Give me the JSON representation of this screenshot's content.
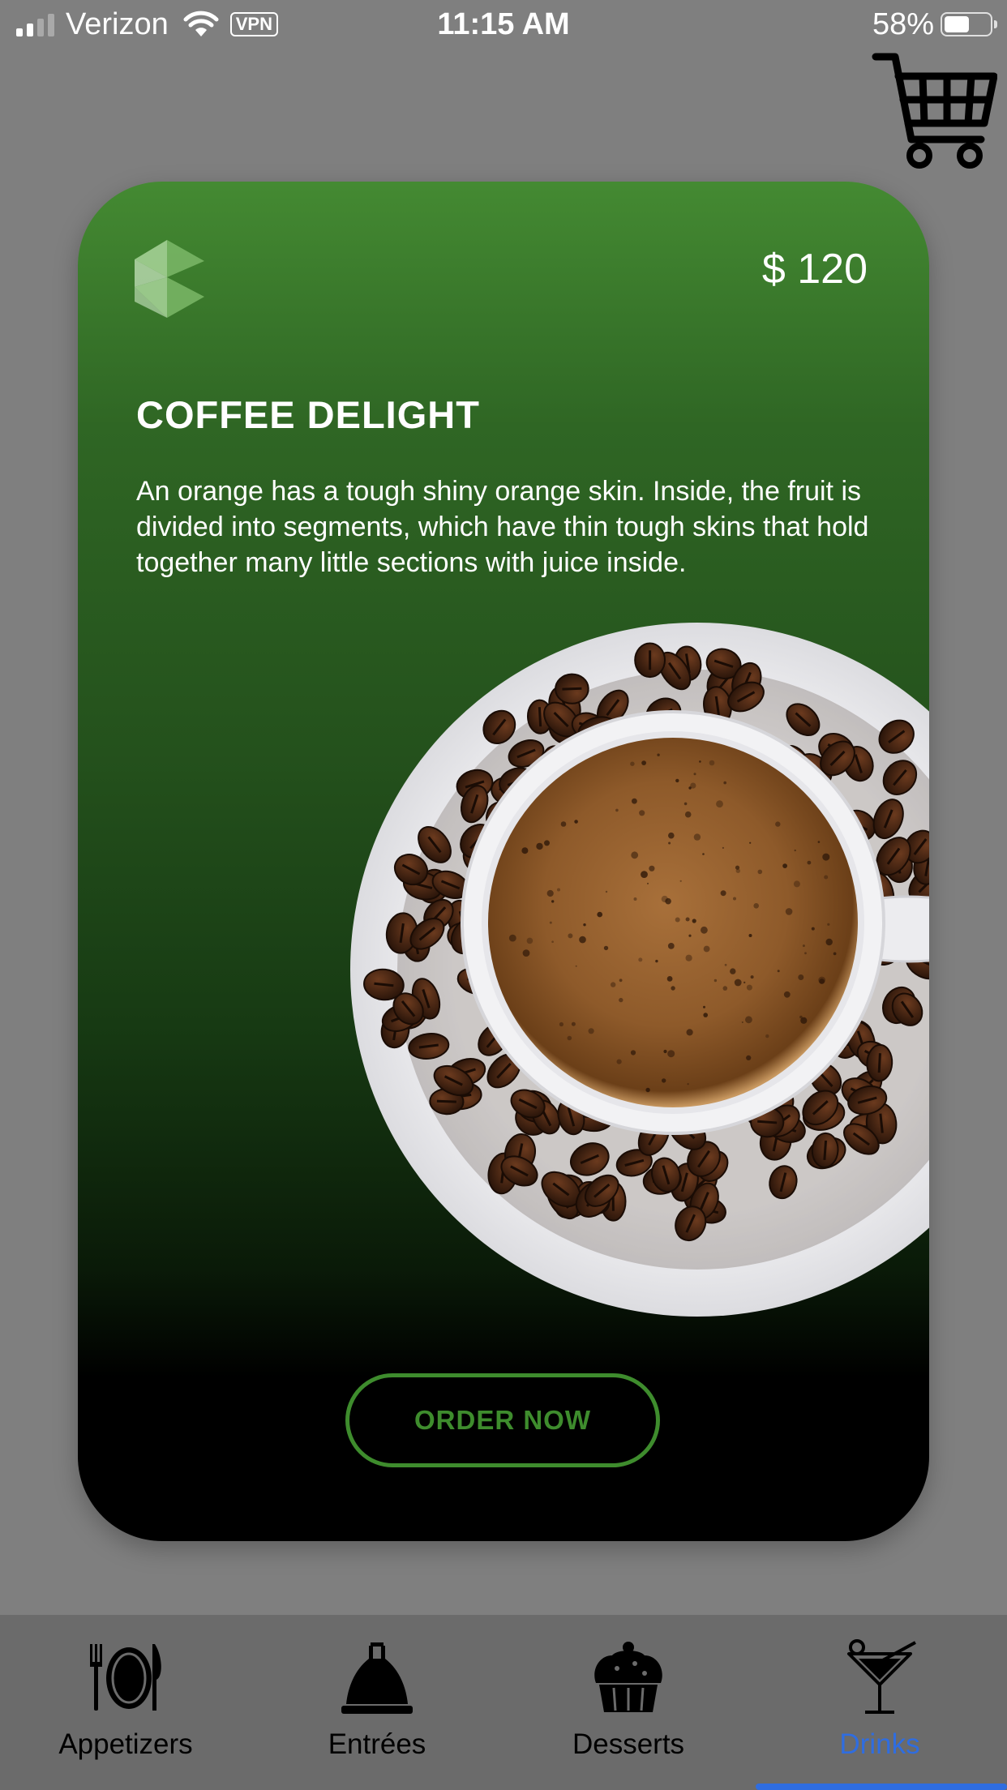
{
  "status_bar": {
    "carrier": "Verizon",
    "vpn": "VPN",
    "time": "11:15 AM",
    "battery": "58%",
    "battery_level": 0.58
  },
  "card": {
    "price": "$ 120",
    "title": "COFFEE DELIGHT",
    "description": "An orange has a tough shiny orange skin. Inside, the fruit is divided into segments, which have thin tough skins that hold together many little sections with juice inside.",
    "button_label": "ORDER NOW",
    "accent_color": "#3e8c2d"
  },
  "icons": {
    "cart": "shopping-cart-icon",
    "logo": "brand-logo-icon"
  },
  "tabs": [
    {
      "label": "Appetizers",
      "icon": "plate-cutlery-icon"
    },
    {
      "label": "Entrées",
      "icon": "cloche-icon"
    },
    {
      "label": "Desserts",
      "icon": "cupcake-icon"
    },
    {
      "label": "Drinks",
      "icon": "cocktail-icon",
      "active": true
    }
  ],
  "active_tab_color": "#2f6de0"
}
